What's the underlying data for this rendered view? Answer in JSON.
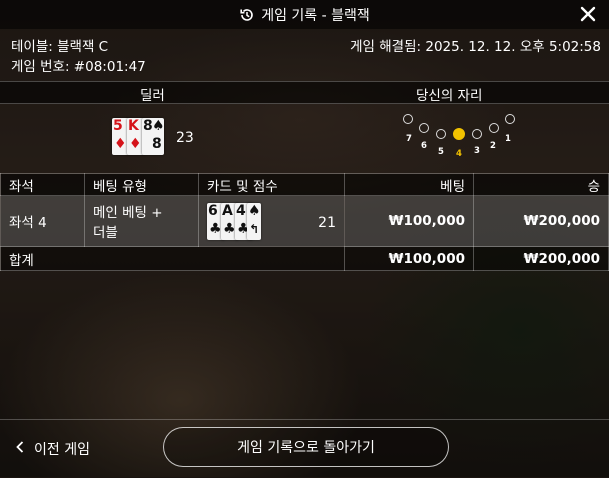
{
  "header": {
    "title": "게임 기록 - 블랙잭",
    "history_icon": "history-icon",
    "close_icon": "close-icon"
  },
  "info": {
    "table": "테이블: 블랙잭 C",
    "game_number": "게임 번호: #08:01:47",
    "settled": "게임 해결됨: 2025. 12. 12. 오후 5:02:58"
  },
  "sections": {
    "dealer": "딜러",
    "your_seat": "당신의 자리"
  },
  "dealer": {
    "cards": [
      {
        "rank": "5",
        "suit": "♦",
        "color": "#d5131a"
      },
      {
        "rank": "K",
        "suit": "♦",
        "color": "#d5131a"
      },
      {
        "rank": "8",
        "suit": "♠",
        "color": "#111111"
      }
    ],
    "score": "23"
  },
  "seat_map": {
    "numbers": [
      "7",
      "6",
      "5",
      "4",
      "3",
      "2",
      "1"
    ],
    "selected": "4",
    "accent": "#f2c200"
  },
  "table": {
    "headers": {
      "seat": "좌석",
      "bet_type": "베팅 유형",
      "cards": "카드 및 점수",
      "bet": "베팅",
      "win": "승"
    },
    "rows": [
      {
        "seat": "좌석 4",
        "bet_type_line1": "메인 베팅 +",
        "bet_type_line2": "더블",
        "cards": [
          {
            "rank": "6",
            "suit": "♣",
            "color": "#111111"
          },
          {
            "rank": "A",
            "suit": "♣",
            "color": "#111111"
          },
          {
            "rank": "4",
            "suit": "♣",
            "color": "#111111"
          },
          {
            "rank": "",
            "suit": "♠",
            "color": "#111111"
          }
        ],
        "score": "21",
        "bet": "₩100,000",
        "win": "₩200,000"
      }
    ],
    "total": {
      "label": "합계",
      "bet": "₩100,000",
      "win": "₩200,000"
    }
  },
  "footer": {
    "prev_label": "이전 게임",
    "back_label": "게임 기록으로 돌아가기",
    "chevron_icon": "chevron-left-icon"
  }
}
